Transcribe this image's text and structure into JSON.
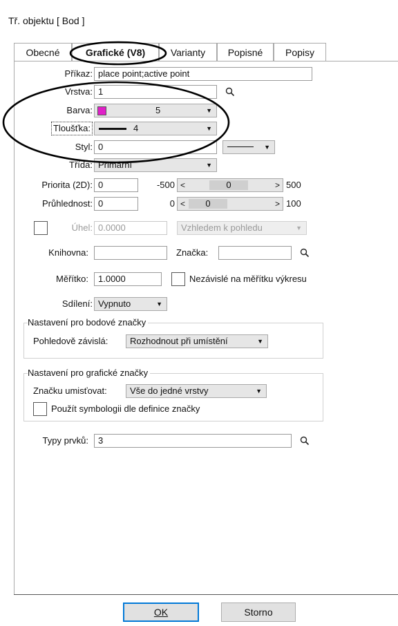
{
  "window": {
    "title": "Tř. objektu [ Bod ]"
  },
  "tabs": [
    "Obecné",
    "Grafické (V8)",
    "Varianty",
    "Popisné",
    "Popisy"
  ],
  "form": {
    "prikaz": {
      "label": "Příkaz:",
      "value": "place point;active point"
    },
    "vrstva": {
      "label": "Vrstva:",
      "value": "1"
    },
    "barva": {
      "label": "Barva:",
      "value": "5",
      "swatch": "#e020c8"
    },
    "tloustka": {
      "label": "Tloušťka:",
      "value": "4"
    },
    "styl": {
      "label": "Styl:",
      "value": "0"
    },
    "trida": {
      "label": "Třída:",
      "value": "Primární"
    },
    "priorita": {
      "label": "Priorita (2D):",
      "value": "0",
      "min": "-500",
      "slider_value": "0",
      "max": "500",
      "level": 0.5
    },
    "pruhlednost": {
      "label": "Průhlednost:",
      "value": "0",
      "min": "0",
      "slider_value": "0",
      "max": "100",
      "level": 0.0
    },
    "uhel": {
      "label": "Úhel:",
      "value": "0.0000",
      "mode": "Vzhledem k pohledu"
    },
    "knihovna": {
      "label": "Knihovna:",
      "value": ""
    },
    "znacka": {
      "label": "Značka:",
      "value": ""
    },
    "meritko": {
      "label": "Měřítko:",
      "value": "1.0000",
      "checkbox_label": "Nezávislé na měřítku výkresu"
    },
    "sdileni": {
      "label": "Sdílení:",
      "value": "Vypnuto"
    }
  },
  "group_bodove": {
    "title": "Nastavení pro bodové značky",
    "label": "Pohledově závislá:",
    "value": "Rozhodnout při umístění"
  },
  "group_graficke": {
    "title": "Nastavení pro grafické značky",
    "label": "Značku umisťovat:",
    "value": "Vše do jedné vrstvy",
    "checkbox_label": "Použít symbologii dle definice značky"
  },
  "typy_prvku": {
    "label": "Typy prvků:",
    "value": "3"
  },
  "buttons": {
    "ok": "OK",
    "storno": "Storno"
  },
  "colors": {
    "accent": "#0078d7",
    "annotation": "#000000"
  }
}
